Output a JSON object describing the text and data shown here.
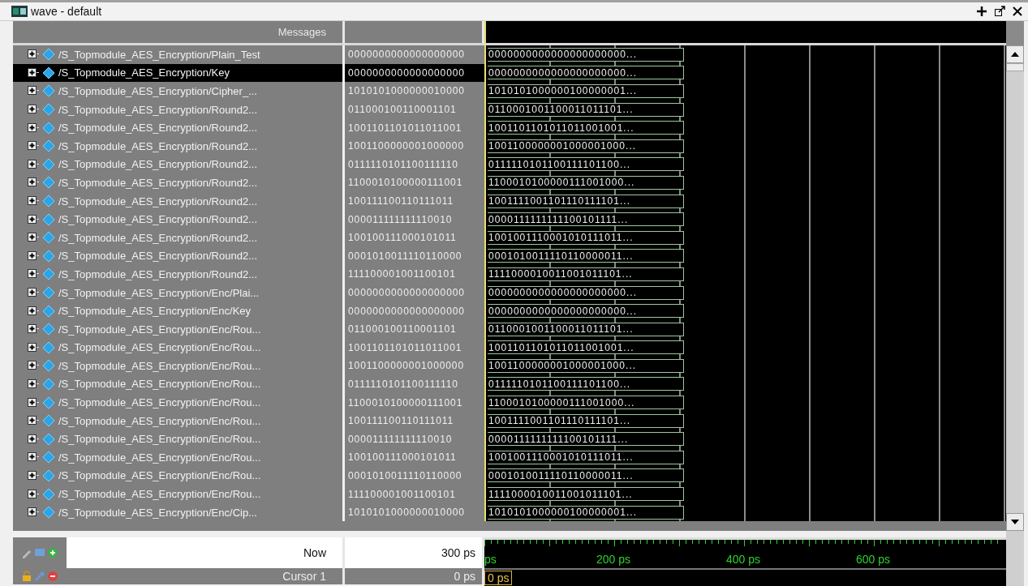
{
  "window": {
    "title": "wave - default"
  },
  "header": {
    "messages": "Messages"
  },
  "signals": [
    {
      "name": "/S_Topmodule_AES_Encryption/Plain_Test",
      "value": "0000000000000000000",
      "wave": "0000000000000000000000...",
      "selected": false,
      "expanded": false
    },
    {
      "name": "/S_Topmodule_AES_Encryption/Key",
      "value": "0000000000000000000",
      "wave": "0000000000000000000000...",
      "selected": true,
      "expanded": false
    },
    {
      "name": "/S_Topmodule_AES_Encryption/Cipher_...",
      "value": "1010101000000010000",
      "wave": "1010101000000100000001...",
      "selected": false,
      "expanded": false
    },
    {
      "name": "/S_Topmodule_AES_Encryption/Round2...",
      "value": "011000100110001101",
      "wave": "0110001001100011011101...",
      "selected": false,
      "expanded": false
    },
    {
      "name": "/S_Topmodule_AES_Encryption/Round2...",
      "value": "1001101101011011001",
      "wave": "1001101101011011001001...",
      "selected": false,
      "expanded": false
    },
    {
      "name": "/S_Topmodule_AES_Encryption/Round2...",
      "value": "1001100000001000000",
      "wave": "1001100000001000001000...",
      "selected": false,
      "expanded": false
    },
    {
      "name": "/S_Topmodule_AES_Encryption/Round2...",
      "value": "0111110101100111110",
      "wave": "0111110101100111101100...",
      "selected": false,
      "expanded": false
    },
    {
      "name": "/S_Topmodule_AES_Encryption/Round2...",
      "value": "1100010100000111001",
      "wave": "1100010100000111001000...",
      "selected": false,
      "expanded": false
    },
    {
      "name": "/S_Topmodule_AES_Encryption/Round2...",
      "value": "100111100110111011",
      "wave": "1001111001101110111101...",
      "selected": false,
      "expanded": false
    },
    {
      "name": "/S_Topmodule_AES_Encryption/Round2...",
      "value": "000011111111110010",
      "wave": "0000111111111100101111...",
      "selected": false,
      "expanded": false
    },
    {
      "name": "/S_Topmodule_AES_Encryption/Round2...",
      "value": "100100111000101011",
      "wave": "1001001110001010111011...",
      "selected": false,
      "expanded": false
    },
    {
      "name": "/S_Topmodule_AES_Encryption/Round2...",
      "value": "0001010011110110000",
      "wave": "0001010011110110000011...",
      "selected": false,
      "expanded": false
    },
    {
      "name": "/S_Topmodule_AES_Encryption/Round2...",
      "value": "111100001001100101",
      "wave": "1111000010011001011101...",
      "selected": false,
      "expanded": false
    },
    {
      "name": "/S_Topmodule_AES_Encryption/Enc/Plai...",
      "value": "0000000000000000000",
      "wave": "0000000000000000000000...",
      "selected": false,
      "expanded": false
    },
    {
      "name": "/S_Topmodule_AES_Encryption/Enc/Key",
      "value": "0000000000000000000",
      "wave": "0000000000000000000000...",
      "selected": false,
      "expanded": false
    },
    {
      "name": "/S_Topmodule_AES_Encryption/Enc/Rou...",
      "value": "011000100110001101",
      "wave": "0110001001100011011101...",
      "selected": false,
      "expanded": false
    },
    {
      "name": "/S_Topmodule_AES_Encryption/Enc/Rou...",
      "value": "1001101101011011001",
      "wave": "1001101101011011001001...",
      "selected": false,
      "expanded": false
    },
    {
      "name": "/S_Topmodule_AES_Encryption/Enc/Rou...",
      "value": "1001100000001000000",
      "wave": "1001100000001000001000...",
      "selected": false,
      "expanded": false
    },
    {
      "name": "/S_Topmodule_AES_Encryption/Enc/Rou...",
      "value": "0111110101100111110",
      "wave": "0111110101100111101100...",
      "selected": false,
      "expanded": false
    },
    {
      "name": "/S_Topmodule_AES_Encryption/Enc/Rou...",
      "value": "1100010100000111001",
      "wave": "1100010100000111001000...",
      "selected": false,
      "expanded": false
    },
    {
      "name": "/S_Topmodule_AES_Encryption/Enc/Rou...",
      "value": "100111100110111011",
      "wave": "1001111001101110111101...",
      "selected": false,
      "expanded": false
    },
    {
      "name": "/S_Topmodule_AES_Encryption/Enc/Rou...",
      "value": "000011111111110010",
      "wave": "0000111111111100101111...",
      "selected": false,
      "expanded": false
    },
    {
      "name": "/S_Topmodule_AES_Encryption/Enc/Rou...",
      "value": "100100111000101011",
      "wave": "1001001110001010111011...",
      "selected": false,
      "expanded": false
    },
    {
      "name": "/S_Topmodule_AES_Encryption/Enc/Rou...",
      "value": "0001010011110110000",
      "wave": "0001010011110110000011...",
      "selected": false,
      "expanded": false
    },
    {
      "name": "/S_Topmodule_AES_Encryption/Enc/Rou...",
      "value": "111100001001100101",
      "wave": "1111000010011001011101...",
      "selected": false,
      "expanded": false
    },
    {
      "name": "/S_Topmodule_AES_Encryption/Enc/Cip...",
      "value": "1010101000000010000",
      "wave": "1010101000000100000001...",
      "selected": false,
      "expanded": false
    }
  ],
  "footer": {
    "now": {
      "label": "Now",
      "value": "300 ps"
    },
    "cursor": {
      "label": "Cursor 1",
      "value": "0 ps",
      "marker": "0 ps"
    }
  },
  "timeline": {
    "labels": [
      "ps",
      "200 ps",
      "400 ps",
      "600 ps"
    ]
  }
}
